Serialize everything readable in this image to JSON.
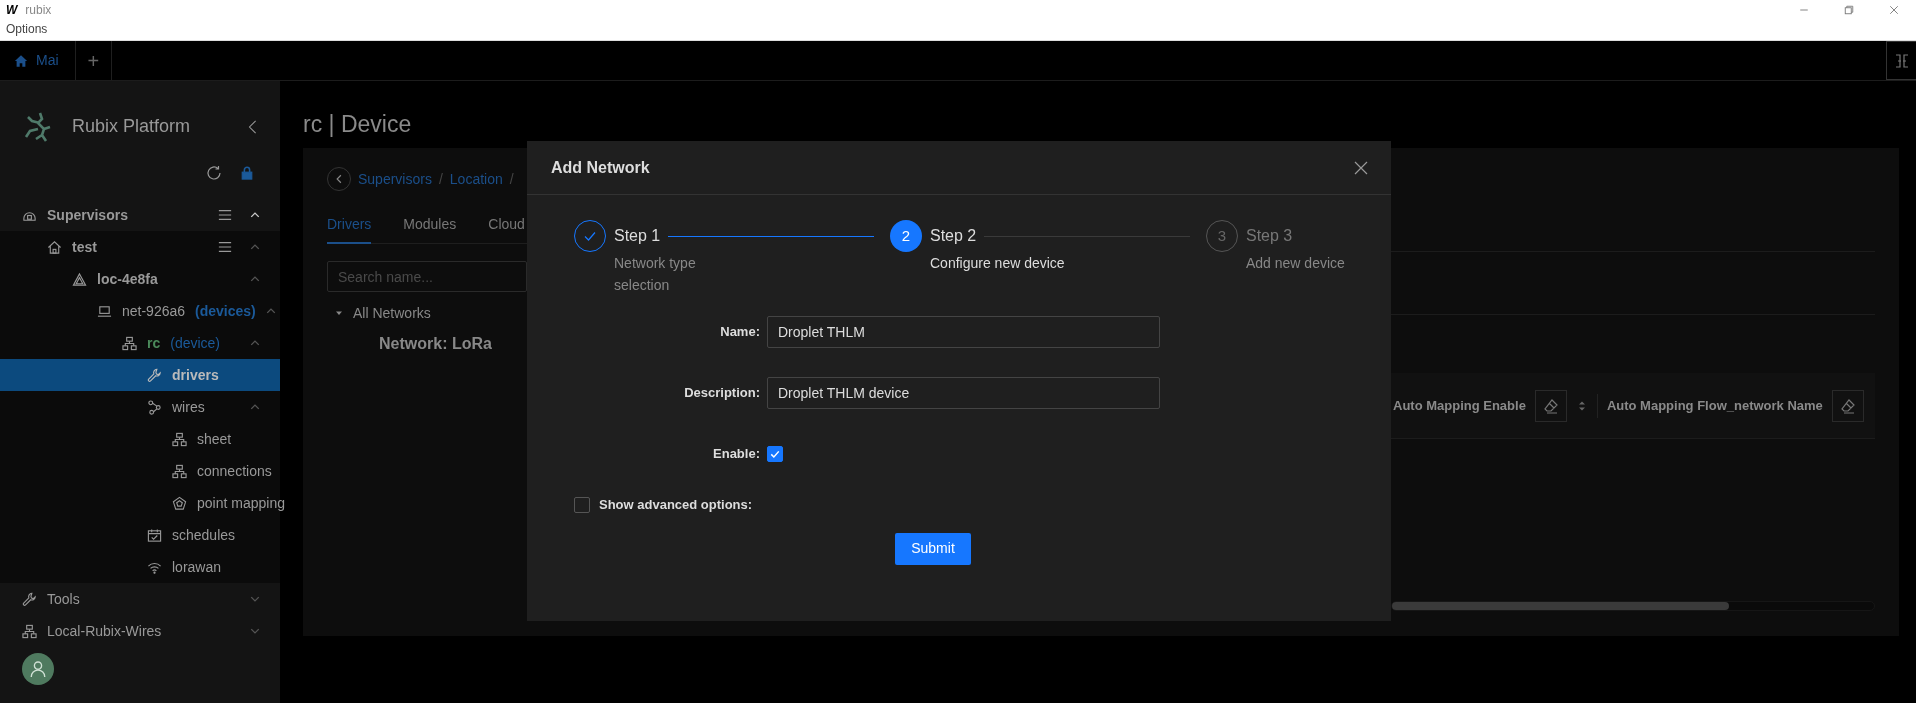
{
  "window": {
    "logo": "W",
    "title": "rubix",
    "menu": [
      "Options"
    ]
  },
  "tabs": [
    {
      "label": "Mai",
      "kind": "home",
      "selected": true
    }
  ],
  "new_tab_button": "+",
  "sidebar": {
    "brand": "Rubix Platform",
    "tree": [
      {
        "label": "Supervisors",
        "kind": "supervisor",
        "menu": true,
        "expanded": true,
        "selected": false,
        "children": [
          {
            "label": "test",
            "kind": "site",
            "menu": true,
            "expanded": true,
            "selected": false,
            "children": [
              {
                "label": "loc-4e8fa",
                "kind": "location",
                "expanded": true,
                "selected": false,
                "children": [
                  {
                    "label": "net-926a6",
                    "tag": "(devices)",
                    "kind": "network",
                    "expanded": true,
                    "selected": false,
                    "children": [
                      {
                        "label": "rc",
                        "tag": "(device)",
                        "kind": "device",
                        "expanded": true,
                        "selected": false,
                        "children": [
                          {
                            "label": "drivers",
                            "kind": "driver",
                            "selected": true
                          },
                          {
                            "label": "wires",
                            "kind": "wires",
                            "expanded": true,
                            "selected": false,
                            "children": [
                              {
                                "label": "sheet",
                                "kind": "sheet",
                                "selected": false
                              },
                              {
                                "label": "connections",
                                "kind": "sheet",
                                "selected": false
                              },
                              {
                                "label": "point mapping",
                                "kind": "mapping",
                                "selected": false
                              }
                            ]
                          },
                          {
                            "label": "schedules",
                            "kind": "schedule",
                            "selected": false
                          },
                          {
                            "label": "lorawan",
                            "kind": "lorawan",
                            "selected": false
                          }
                        ]
                      }
                    ]
                  }
                ]
              }
            ]
          }
        ]
      },
      {
        "label": "Tools",
        "kind": "tools",
        "expanded": false,
        "selected": false
      },
      {
        "label": "Local-Rubix-Wires",
        "kind": "host",
        "expanded": false,
        "selected": false
      }
    ]
  },
  "page": {
    "title": "rc | Device",
    "breadcrumb": [
      {
        "kind": "link",
        "text": "Supervisors"
      },
      {
        "kind": "separator",
        "text": "/"
      },
      {
        "kind": "link",
        "text": "Location"
      },
      {
        "kind": "separator",
        "text": "/"
      }
    ],
    "tabs": [
      {
        "label": "Drivers",
        "selected": true
      },
      {
        "label": "Modules",
        "selected": false
      },
      {
        "label": "Cloud",
        "selected": false
      }
    ],
    "search": {
      "placeholder": "Search name..."
    },
    "network_tree": {
      "label": "All Networks",
      "expanded": true,
      "children": [
        {
          "label": "Network: LoRa"
        }
      ]
    },
    "table": {
      "columns": [
        "Auto Mapping Enable",
        "Auto Mapping Flow_network Name"
      ]
    }
  },
  "modal": {
    "title": "Add Network",
    "steps": [
      {
        "title": "Step 1",
        "subtitle": "Network type selection",
        "kind": "done"
      },
      {
        "number": "2",
        "title": "Step 2",
        "subtitle": "Configure new device",
        "kind": "active"
      },
      {
        "number": "3",
        "title": "Step 3",
        "subtitle": "Add new device",
        "kind": "waiting"
      }
    ],
    "fields": [
      {
        "kind": "text",
        "label": "Name:",
        "value": "Droplet THLM"
      },
      {
        "kind": "text",
        "label": "Description:",
        "value": "Droplet THLM device"
      },
      {
        "kind": "checkbox",
        "label": "Enable:",
        "checked": true
      }
    ],
    "advanced": {
      "label": "Show advanced options:",
      "checked": false
    },
    "submit": "Submit"
  }
}
